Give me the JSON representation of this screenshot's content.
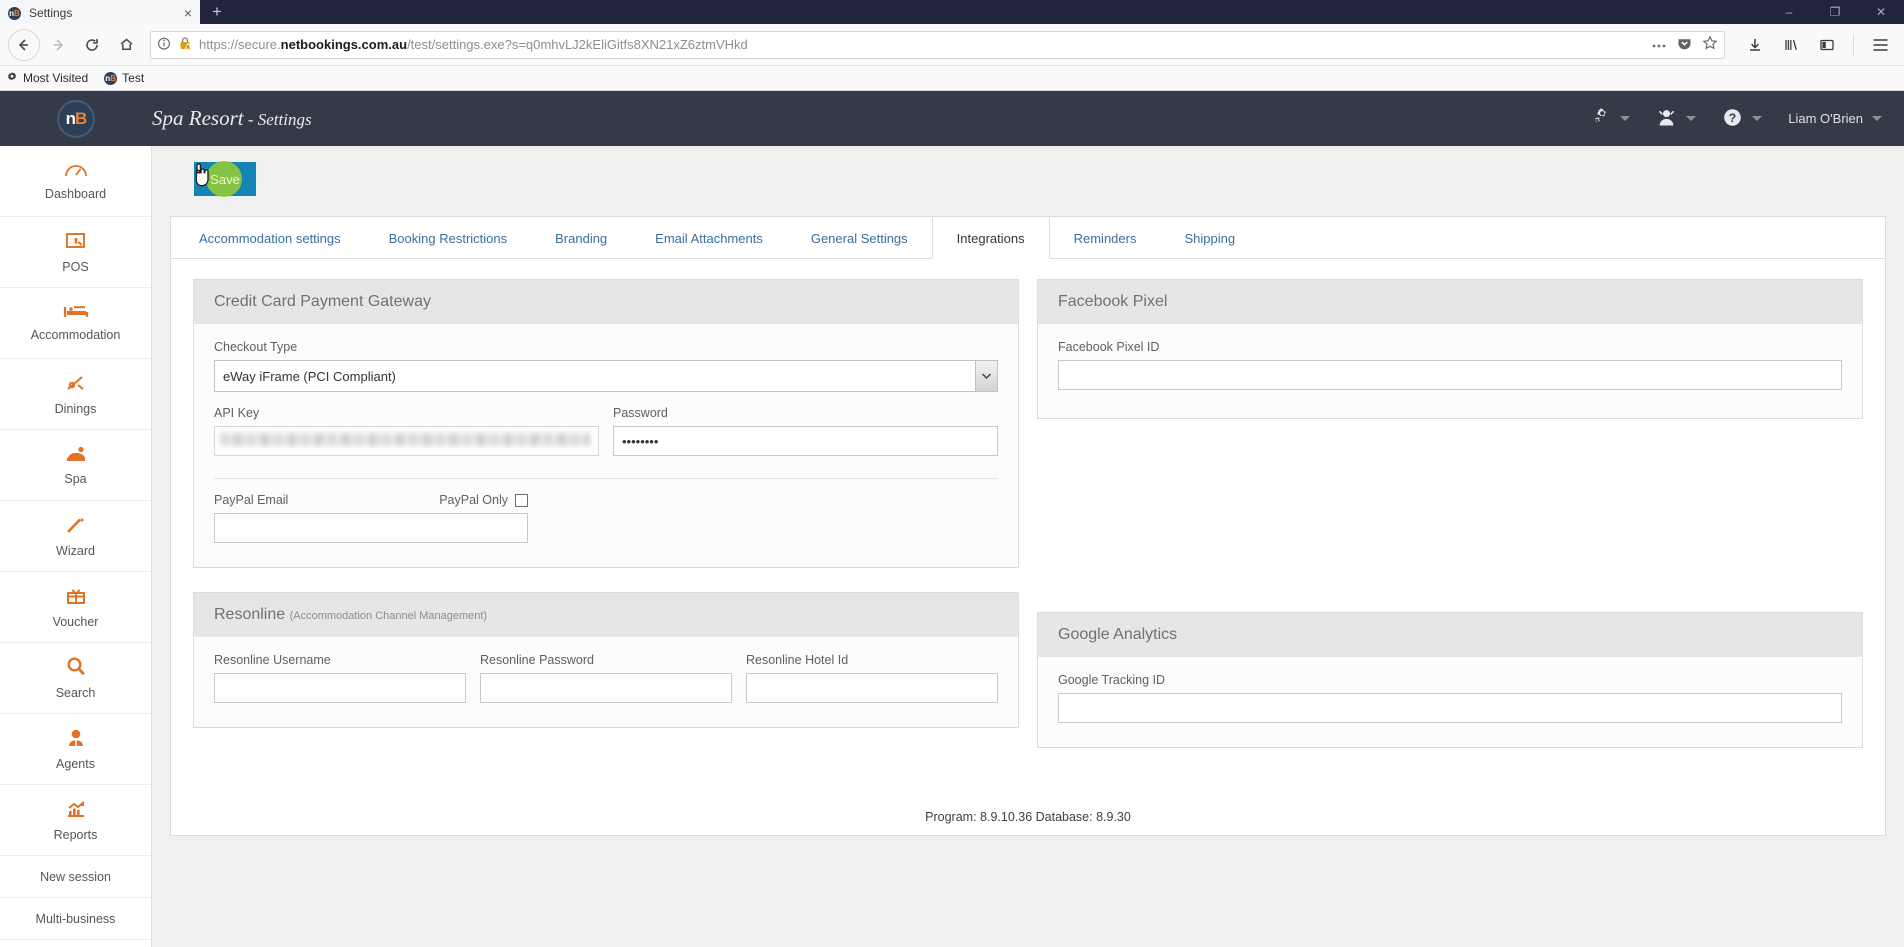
{
  "browser": {
    "tab_title": "Settings",
    "tab_favicon": "nb-logo-icon",
    "new_tab_label": "+",
    "close_tab_label": "×",
    "window_minimize": "–",
    "window_restore": "❐",
    "window_close": "✕",
    "url_prefix": "https://secure.",
    "url_domain": "netbookings.com.au",
    "url_path": "/test/settings.exe?s=q0mhvLJ2kEliGitfs8XN21xZ6ztmVHkd",
    "url_full": "https://secure.netbookings.com.au/test/settings.exe?s=q0mhvLJ2kEliGitfs8XN21xZ6ztmVHkd",
    "bookmarks": [
      {
        "label": "Most Visited",
        "icon": "grid-icon"
      },
      {
        "label": "Test",
        "icon": "nb-logo-icon"
      }
    ]
  },
  "header": {
    "logo_text": "n",
    "logo_accent": "B",
    "business_name": "Spa Resort",
    "page_name": " - Settings",
    "user_name": "Liam O'Brien",
    "icons": [
      "gears-icon",
      "user-icon",
      "help-icon"
    ]
  },
  "sidebar": {
    "items": [
      {
        "label": "Dashboard",
        "icon": "dashboard-gauge-icon"
      },
      {
        "label": "POS",
        "icon": "pos-register-icon"
      },
      {
        "label": "Accommodation",
        "icon": "bed-icon"
      },
      {
        "label": "Dinings",
        "icon": "cutlery-icon"
      },
      {
        "label": "Spa",
        "icon": "massage-icon"
      },
      {
        "label": "Wizard",
        "icon": "magic-wand-icon"
      },
      {
        "label": "Voucher",
        "icon": "gift-icon"
      },
      {
        "label": "Search",
        "icon": "search-icon"
      },
      {
        "label": "Agents",
        "icon": "agent-person-icon"
      },
      {
        "label": "Reports",
        "icon": "chart-growth-icon"
      }
    ],
    "plain_items": [
      {
        "label": "New session"
      },
      {
        "label": "Multi-business"
      }
    ]
  },
  "toolbar": {
    "save_label": "Save"
  },
  "tabs": [
    {
      "label": "Accommodation settings",
      "active": false
    },
    {
      "label": "Booking Restrictions",
      "active": false
    },
    {
      "label": "Branding",
      "active": false
    },
    {
      "label": "Email Attachments",
      "active": false
    },
    {
      "label": "General Settings",
      "active": false
    },
    {
      "label": "Integrations",
      "active": true
    },
    {
      "label": "Reminders",
      "active": false
    },
    {
      "label": "Shipping",
      "active": false
    }
  ],
  "cards": {
    "credit_card": {
      "title": "Credit Card Payment Gateway",
      "checkout_type_label": "Checkout Type",
      "checkout_type_value": "eWay iFrame (PCI Compliant)",
      "api_key_label": "API Key",
      "api_key_value": "",
      "password_label": "Password",
      "password_value": "••••••••",
      "paypal_email_label": "PayPal Email",
      "paypal_email_value": "",
      "paypal_only_label": "PayPal Only",
      "paypal_only_checked": false
    },
    "resonline": {
      "title": "Resonline",
      "subtitle": "(Accommodation Channel Management)",
      "username_label": "Resonline Username",
      "username_value": "",
      "password_label": "Resonline Password",
      "password_value": "",
      "hotel_id_label": "Resonline Hotel Id",
      "hotel_id_value": ""
    },
    "facebook_pixel": {
      "title": "Facebook Pixel",
      "pixel_id_label": "Facebook Pixel ID",
      "pixel_id_value": ""
    },
    "google_analytics": {
      "title": "Google Analytics",
      "tracking_id_label": "Google Tracking ID",
      "tracking_id_value": ""
    }
  },
  "footer": {
    "version_text": "Program: 8.9.10.36 Database: 8.9.30"
  },
  "colors": {
    "accent_orange": "#e27225",
    "header_dark": "#343a47",
    "titlebar_navy": "#22243d",
    "save_blue": "#1484b4",
    "click_green": "#8cc63f",
    "link_blue": "#3c6e9e"
  }
}
